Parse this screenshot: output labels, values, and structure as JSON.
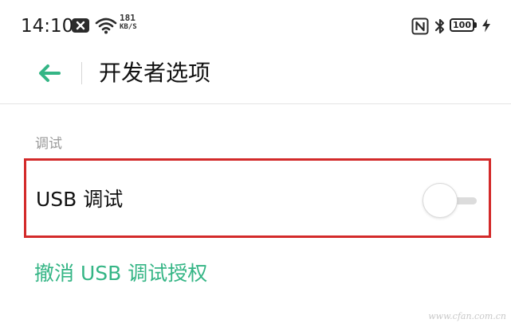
{
  "status_bar": {
    "time": "14:10",
    "net_speed_value": "181",
    "net_speed_unit": "KB/S",
    "battery_level": "100",
    "icons": [
      "notification-close-icon",
      "wifi-icon",
      "nfc-icon",
      "bluetooth-icon",
      "battery-icon",
      "charging-icon"
    ]
  },
  "header": {
    "title": "开发者选项",
    "back_icon": "arrow-left-icon"
  },
  "section": {
    "label": "调试"
  },
  "usb_debugging": {
    "label": "USB 调试",
    "enabled": false
  },
  "revoke_link": {
    "label": "撤消 USB 调试授权"
  },
  "watermark": "www.cfan.com.cn",
  "colors": {
    "accent": "#34b585",
    "highlight_border": "#d32a2a",
    "section_label": "#9a9a9a",
    "divider": "#e4e4e4"
  }
}
